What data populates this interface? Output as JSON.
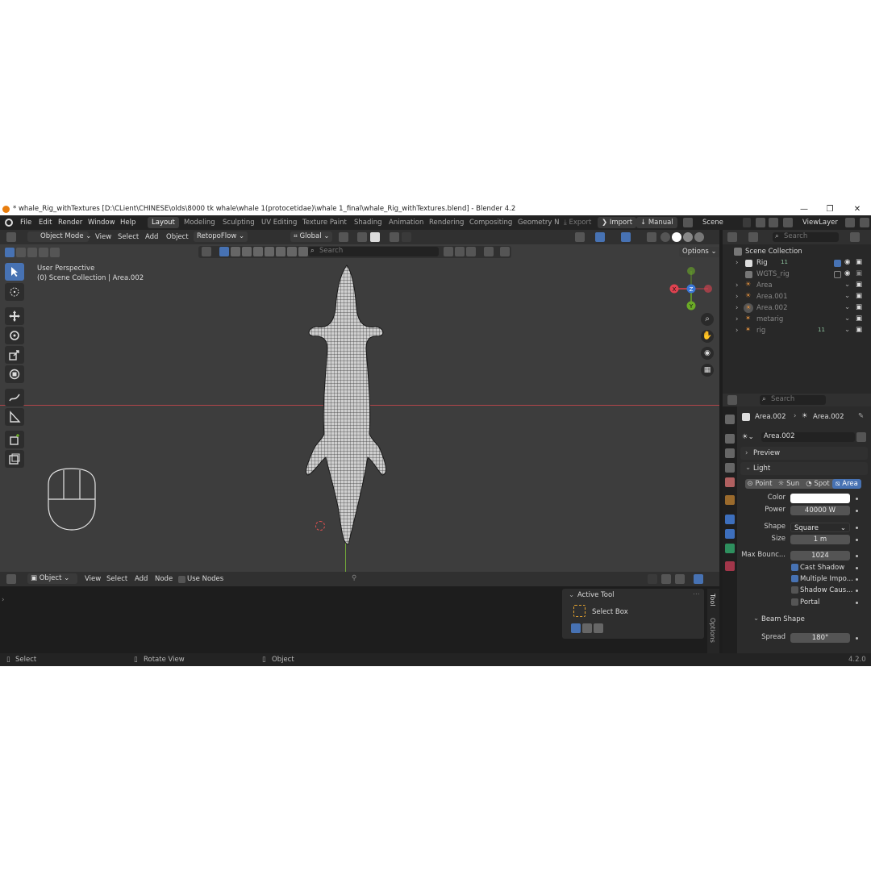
{
  "window": {
    "title": "* whale_Rig_withTextures [D:\\CLient\\CHINESE\\olds\\8000 tk whale\\whale 1(protocetidae)\\whale 1_final\\whale_Rig_withTextures.blend] - Blender 4.2",
    "minimize": "—",
    "maximize": "❐",
    "close": "✕"
  },
  "menu": {
    "items": [
      "File",
      "Edit",
      "Render",
      "Window",
      "Help"
    ],
    "workspaces": [
      "Layout",
      "Modeling",
      "Sculpting",
      "UV Editing",
      "Texture Paint",
      "Shading",
      "Animation",
      "Rendering",
      "Compositing",
      "Geometry N"
    ],
    "export": "Export",
    "import": "Import",
    "manual": "Manual",
    "scene": "Scene",
    "view_layer": "ViewLayer"
  },
  "viewport_header": {
    "mode": "Object Mode",
    "view": "View",
    "select": "Select",
    "add": "Add",
    "object": "Object",
    "addon": "RetopoFlow",
    "transform": "Global",
    "search_placeholder": "Search",
    "options": "Options"
  },
  "viewport": {
    "perspective": "User Perspective",
    "collection": "(0) Scene Collection | Area.002",
    "gizmo": {
      "x": "X",
      "y": "Y",
      "z": "Z"
    }
  },
  "outliner": {
    "search_placeholder": "Search",
    "root": "Scene Collection",
    "rows": [
      {
        "name": "Rig",
        "extra": "11"
      },
      {
        "name": "WGTS_rig",
        "extra": ""
      },
      {
        "name": "Area",
        "extra": ""
      },
      {
        "name": "Area.001",
        "extra": ""
      },
      {
        "name": "Area.002",
        "extra": ""
      },
      {
        "name": "metarig",
        "extra": ""
      },
      {
        "name": "rig",
        "extra": "11"
      }
    ]
  },
  "properties": {
    "search_placeholder": "Search",
    "breadcrumb_object": "Area.002",
    "breadcrumb_data": "Area.002",
    "datablock": "Area.002",
    "preview": "Preview",
    "light": "Light",
    "light_types": [
      "Point",
      "Sun",
      "Spot",
      "Area"
    ],
    "color_label": "Color",
    "color_value": "#ffffff",
    "power_label": "Power",
    "power_value": "40000 W",
    "shape_label": "Shape",
    "shape_value": "Square",
    "size_label": "Size",
    "size_value": "1 m",
    "max_bounce_label": "Max Bounc...",
    "max_bounce_value": "1024",
    "cast_shadow": "Cast Shadow",
    "multiple_importance": "Multiple Impo...",
    "shadow_caustics": "Shadow Caus...",
    "portal": "Portal",
    "beam_shape": "Beam Shape",
    "spread_label": "Spread",
    "spread_value": "180°"
  },
  "node_header": {
    "object": "Object",
    "view": "View",
    "select": "Select",
    "add": "Add",
    "node": "Node",
    "use_nodes": "Use Nodes"
  },
  "active_tool": {
    "title": "Active Tool",
    "tool": "Select Box",
    "tab_tool": "Tool",
    "tab_options": "Options"
  },
  "status": {
    "select": "Select",
    "rotate": "Rotate View",
    "object": "Object",
    "version": "4.2.0"
  },
  "colors": {
    "accent": "#4772b3",
    "axis_x": "#e04250",
    "axis_y": "#6bab27",
    "axis_z": "#3a76d6"
  }
}
